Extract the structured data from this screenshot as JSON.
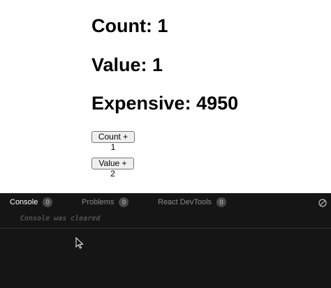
{
  "preview": {
    "count_text": "Count: 1",
    "value_text": "Value: 1",
    "expensive_text": "Expensive: 4950",
    "count_button_label": "Count + 1",
    "value_button_label": "Value + 2"
  },
  "devtools": {
    "tabs": [
      {
        "label": "Console",
        "badge": "0",
        "active": true
      },
      {
        "label": "Problems",
        "badge": "0",
        "active": false
      },
      {
        "label": "React DevTools",
        "badge": "0",
        "active": false
      }
    ],
    "clear_icon": "clear-console-icon",
    "console_message": "Console was cleared"
  },
  "colors": {
    "panel_bg": "#151515",
    "badge_bg": "#4a4a4a",
    "muted_text": "#6e6e6e"
  }
}
